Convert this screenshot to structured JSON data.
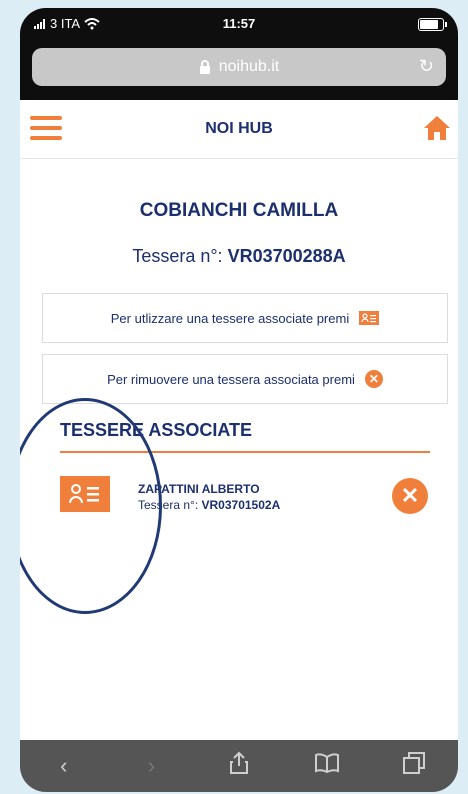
{
  "status": {
    "carrier": "3 ITA",
    "time": "11:57"
  },
  "browser": {
    "url": "noihub.it"
  },
  "nav": {
    "title": "NOI HUB"
  },
  "profile": {
    "name": "COBIANCHI CAMILLA",
    "card_label": "Tessera n°:",
    "card_number": "VR03700288A"
  },
  "info": {
    "add_text": "Per utlizzare una tessere associate premi",
    "remove_text": "Per rimuovere una tessera associata premi"
  },
  "associated": {
    "title": "TESSERE ASSOCIATE",
    "items": [
      {
        "name": "ZAPATTINI ALBERTO",
        "card_label": "Tessera n°:",
        "card_number": "VR03701502A"
      }
    ]
  },
  "colors": {
    "accent": "#f07f3c",
    "primary": "#1c2f6e",
    "annotation": "#213a75"
  }
}
